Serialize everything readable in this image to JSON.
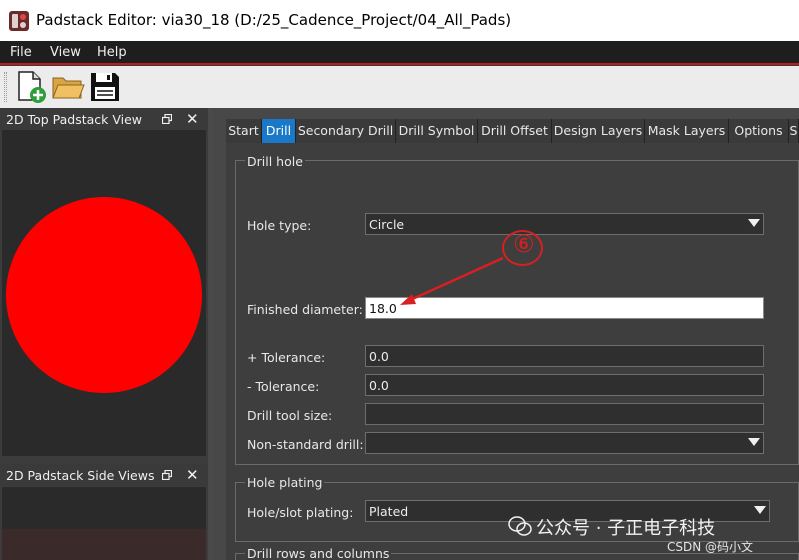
{
  "window": {
    "title": "Padstack Editor: via30_18  (D:/25_Cadence_Project/04_All_Pads)"
  },
  "menu": [
    "File",
    "View",
    "Help"
  ],
  "toolbar": {
    "icons": [
      "new-file-icon",
      "open-folder-icon",
      "save-icon"
    ]
  },
  "top_view": {
    "title": "2D Top Padstack View",
    "pad_color": "#ff0000"
  },
  "side_view": {
    "title": "2D Padstack Side Views"
  },
  "dock_buttons": {
    "close": "✕"
  },
  "tabs": [
    "Start",
    "Drill",
    "Secondary Drill",
    "Drill Symbol",
    "Drill Offset",
    "Design Layers",
    "Mask Layers",
    "Options",
    "S"
  ],
  "active_tab": "Drill",
  "drill_hole": {
    "title": "Drill hole",
    "hole_type": {
      "label": "Hole type:",
      "value": "Circle"
    },
    "finished_diameter": {
      "label": "Finished diameter:",
      "value": "18.0"
    },
    "plus_tolerance": {
      "label": "+ Tolerance:",
      "value": "0.0"
    },
    "minus_tolerance": {
      "label": "- Tolerance:",
      "value": "0.0"
    },
    "drill_tool_size": {
      "label": "Drill tool size:",
      "value": ""
    },
    "non_standard_drill": {
      "label": "Non-standard drill:",
      "value": ""
    }
  },
  "hole_plating": {
    "title": "Hole plating",
    "plating": {
      "label": "Hole/slot plating:",
      "value": "Plated"
    }
  },
  "drill_rows": {
    "title": "Drill rows and columns"
  },
  "annotation": {
    "number": "⑥",
    "color": "#d82020"
  },
  "watermark": {
    "text": "公众号 · 子正电子科技",
    "credit": "CSDN @码小文"
  }
}
